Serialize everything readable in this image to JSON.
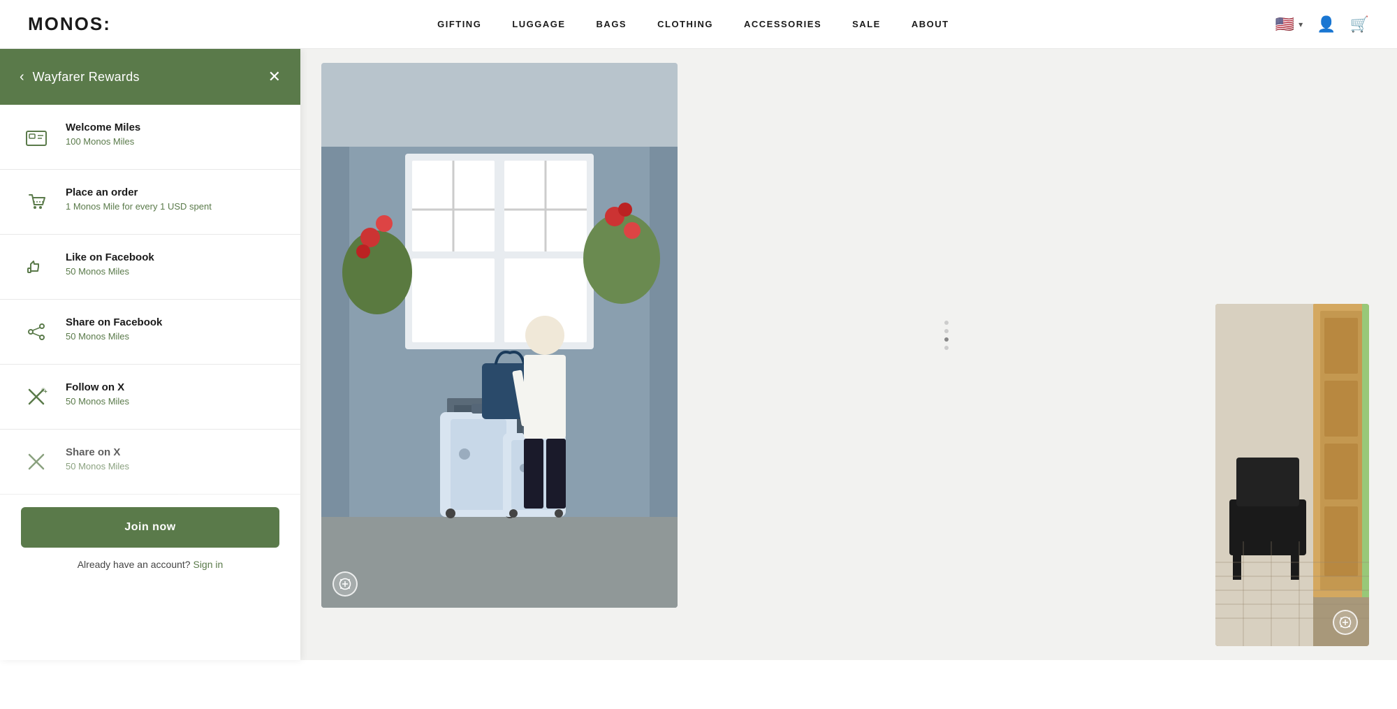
{
  "header": {
    "logo": "MONOS:",
    "nav": [
      {
        "label": "GIFTING",
        "id": "gifting"
      },
      {
        "label": "LUGGAGE",
        "id": "luggage"
      },
      {
        "label": "BAGS",
        "id": "bags"
      },
      {
        "label": "CLOTHING",
        "id": "clothing"
      },
      {
        "label": "ACCESSORIES",
        "id": "accessories"
      },
      {
        "label": "SALE",
        "id": "sale"
      },
      {
        "label": "ABOUT",
        "id": "about"
      }
    ],
    "flag": "🇺🇸",
    "flag_label": "US Flag"
  },
  "rewards_panel": {
    "title": "Wayfarer Rewards",
    "back_label": "‹",
    "close_label": "✕",
    "items": [
      {
        "id": "welcome",
        "icon": "🏪",
        "name": "Welcome Miles",
        "desc": "100 Monos Miles"
      },
      {
        "id": "order",
        "icon": "🛍",
        "name": "Place an order",
        "desc": "1 Monos Mile for every 1 USD spent"
      },
      {
        "id": "facebook-like",
        "icon": "👍",
        "name": "Like on Facebook",
        "desc": "50 Monos Miles"
      },
      {
        "id": "facebook-share",
        "icon": "📘",
        "name": "Share on Facebook",
        "desc": "50 Monos Miles"
      },
      {
        "id": "x-follow",
        "icon": "✖",
        "name": "Follow on X",
        "desc": "50 Monos Miles"
      },
      {
        "id": "x-share",
        "icon": "✖",
        "name": "Share on X",
        "desc": "50 Monos Miles"
      }
    ],
    "join_label": "Join now",
    "signin_text": "Already have an account?",
    "signin_link": "Sign in"
  },
  "images": {
    "main_alt": "Person with luggage",
    "side_alt": "Room interior"
  },
  "zoom_icon": "⊕",
  "dots": [
    false,
    false,
    true,
    false
  ]
}
